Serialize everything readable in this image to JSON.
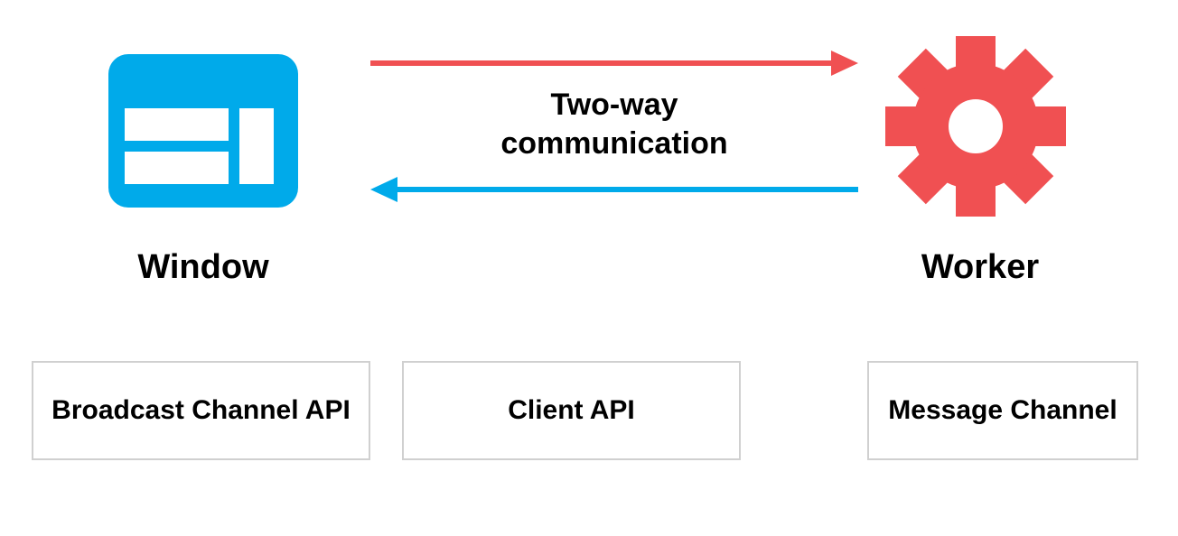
{
  "colors": {
    "window_blue": "#00aaea",
    "gear_red": "#f05052",
    "arrow_red": "#f05052",
    "arrow_blue": "#00aaea",
    "box_border": "#d0d0d0",
    "text": "#000000"
  },
  "window": {
    "label": "Window",
    "icon": "browser-window-icon"
  },
  "worker": {
    "label": "Worker",
    "icon": "gear-icon"
  },
  "center": {
    "line1": "Two-way",
    "line2": "communication"
  },
  "api_boxes": {
    "broadcast": "Broadcast Channel API",
    "client": "Client API",
    "message": "Message Channel"
  }
}
